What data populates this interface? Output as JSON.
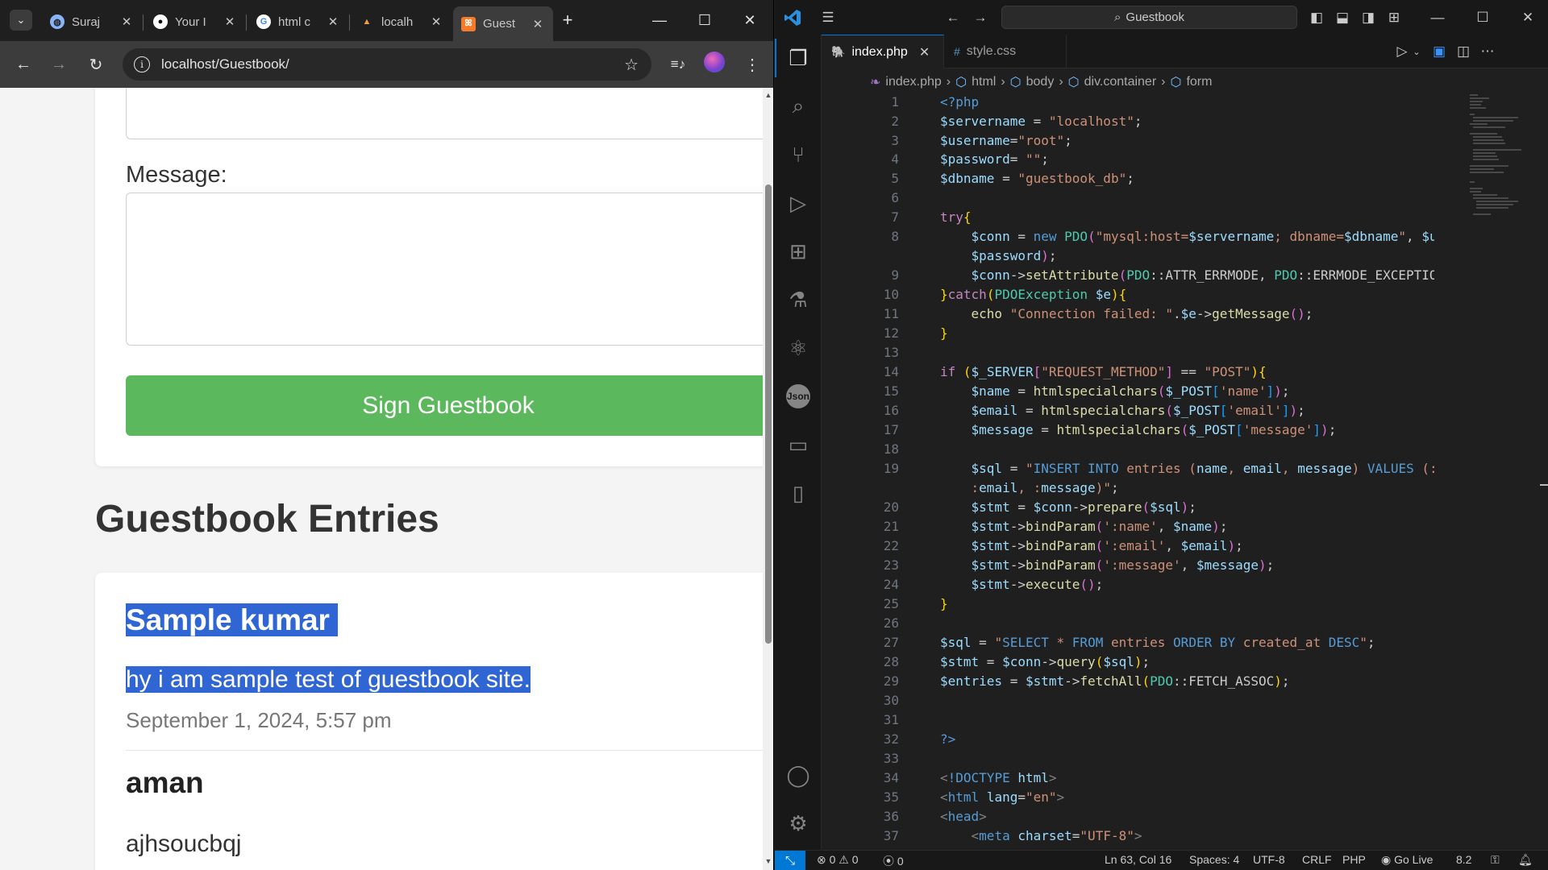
{
  "browser": {
    "tabs": [
      {
        "label": "Suraj",
        "icon": "globe-icon"
      },
      {
        "label": "Your I",
        "icon": "github-icon"
      },
      {
        "label": "html c",
        "icon": "google-icon"
      },
      {
        "label": "localh",
        "icon": "xampp-icon"
      },
      {
        "label": "Guest",
        "icon": "xampp-icon",
        "active": true
      }
    ],
    "url": "localhost/Guestbook/",
    "page": {
      "message_label": "Message:",
      "submit_label": "Sign Guestbook",
      "entries_heading": "Guestbook Entries",
      "entries": [
        {
          "name": "Sample kumar",
          "message": "hy i am sample test of guestbook site.",
          "date": "September 1, 2024, 5:57 pm"
        },
        {
          "name": "aman",
          "message": "ajhsoucbqj",
          "date": ""
        }
      ]
    }
  },
  "vscode": {
    "search_text": "Guestbook",
    "tabs": [
      {
        "label": "index.php",
        "active": true
      },
      {
        "label": "style.css",
        "active": false
      }
    ],
    "breadcrumb": [
      "index.php",
      "html",
      "body",
      "div.container",
      "form"
    ],
    "status": {
      "errors": "0",
      "warnings": "0",
      "ports": "0",
      "position": "Ln 63, Col 16",
      "spaces": "Spaces: 4",
      "encoding": "UTF-8",
      "eol": "CRLF",
      "language": "PHP",
      "golive": "Go Live",
      "version": "8.2"
    }
  },
  "colors": {
    "accent": "#0078d4",
    "submit": "#5cb85c",
    "selection": "#2f66d4"
  }
}
